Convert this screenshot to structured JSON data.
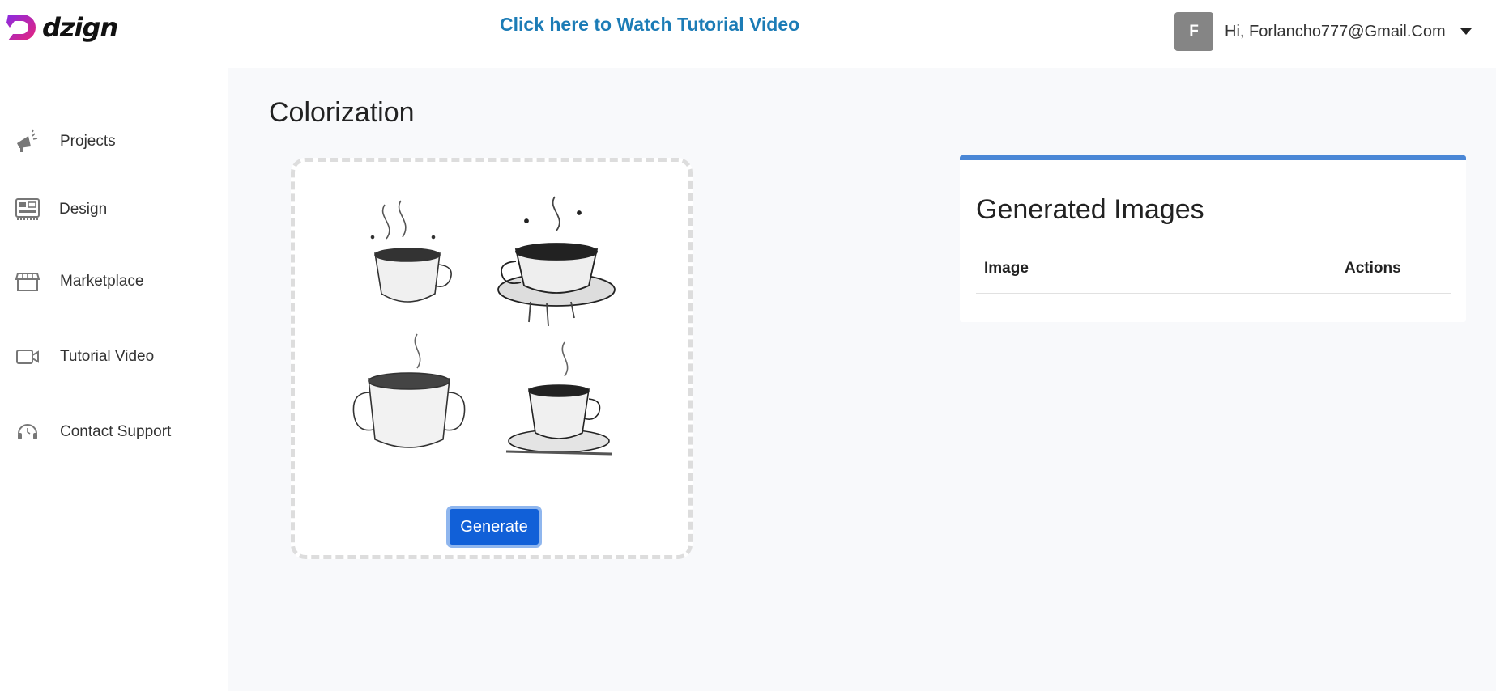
{
  "brand": {
    "name": "dzign"
  },
  "header": {
    "tutorial_link": "Click here to Watch Tutorial Video",
    "user": {
      "avatar_initial": "F",
      "greeting": "Hi, Forlancho777@Gmail.Com"
    }
  },
  "sidebar": {
    "items": [
      {
        "label": "Projects",
        "icon": "megaphone-icon"
      },
      {
        "label": "Design",
        "icon": "design-icon"
      },
      {
        "label": "Marketplace",
        "icon": "store-icon"
      },
      {
        "label": "Tutorial Video",
        "icon": "video-camera-icon"
      },
      {
        "label": "Contact Support",
        "icon": "headset-icon"
      }
    ]
  },
  "main": {
    "title": "Colorization",
    "upload": {
      "sample_images": [
        "coffee-cup-sketch-1",
        "coffee-cup-sketch-2",
        "coffee-cup-sketch-3",
        "coffee-cup-sketch-4"
      ],
      "generate_label": "Generate"
    },
    "generated": {
      "title": "Generated Images",
      "columns": [
        "Image",
        "Actions"
      ],
      "rows": []
    }
  },
  "colors": {
    "accent": "#1160d8",
    "link": "#1c7cb6",
    "panel_border": "#4a87d6"
  }
}
